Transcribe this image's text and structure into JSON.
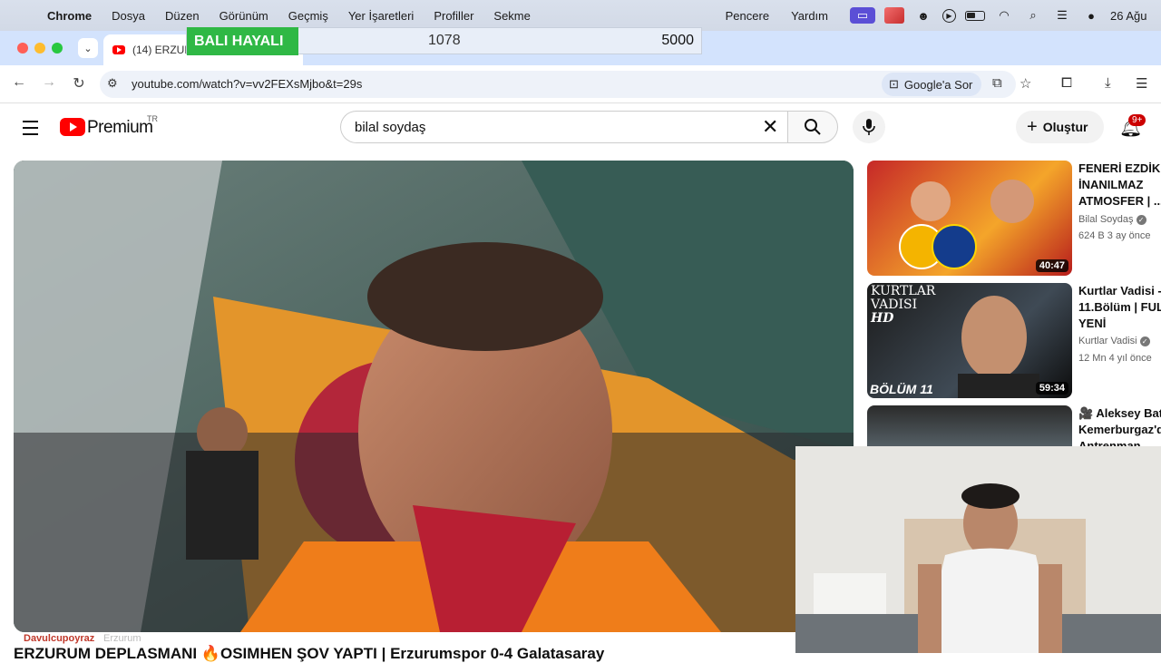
{
  "menubar": {
    "app": "Chrome",
    "items": [
      "Dosya",
      "Düzen",
      "Görünüm",
      "Geçmiş",
      "Yer İşaretleri",
      "Profiller",
      "Sekme"
    ],
    "right_items": [
      "Pencere",
      "Yardım"
    ],
    "clock": "26 Ağu"
  },
  "browser": {
    "tab_title": "(14) ERZUR",
    "url": "youtube.com/watch?v=vv2FEXsMjbo&t=29s",
    "ask_google": "Google'a Sor"
  },
  "overlay": {
    "label": "BALI HAYALI",
    "value_left": "1078",
    "value_right": "5000"
  },
  "youtube": {
    "logo_text": "Premium",
    "country": "TR",
    "search_value": "bilal soydaş",
    "create_label": "Oluştur",
    "notif_badge": "9+"
  },
  "video": {
    "channel_tag": "Davulcupoyraz",
    "location_tag": "Erzurum",
    "title": "ERZURUM DEPLASMANI 🔥OSIMHEN ŞOV YAPTI | Erzurumspor 0-4 Galatasaray"
  },
  "recommendations": [
    {
      "title1": "FENERİ EZDİK 🔥",
      "title2": "İNANILMAZ",
      "title3": "ATMOSFER | ...",
      "channel": "Bilal Soydaş",
      "meta": "624 B  3 ay önce",
      "duration": "40:47"
    },
    {
      "title1": "Kurtlar Vadisi -",
      "title2": "11.Bölüm | FULL",
      "title3": "YENİ",
      "channel": "Kurtlar Vadisi",
      "meta": "12 Mn  4 yıl önce",
      "duration": "59:34",
      "thumb_text1": "KURTLAR",
      "thumb_text2": "VADISI",
      "thumb_hd": "HD",
      "thumb_ep": "BÖLÜM 11"
    },
    {
      "title1": "🎥 Aleksey Batr",
      "title2": "Kemerburgaz'da",
      "title3": "Antrenman..."
    }
  ]
}
